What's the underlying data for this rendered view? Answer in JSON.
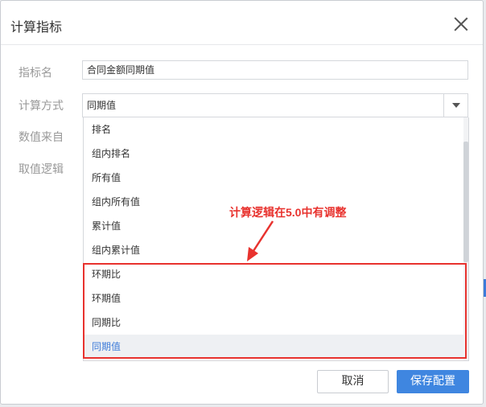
{
  "dialog": {
    "title": "计算指标",
    "close_icon": "close-icon"
  },
  "form": {
    "name_label": "指标名",
    "name_value": "合同金额同期值",
    "calc_label": "计算方式",
    "calc_value": "同期值",
    "source_label": "数值来自",
    "logic_label": "取值逻辑"
  },
  "dropdown": {
    "options": [
      "排名",
      "组内排名",
      "所有值",
      "组内所有值",
      "累计值",
      "组内累计值",
      "环期比",
      "环期值",
      "同期比",
      "同期值"
    ],
    "selected": "同期值"
  },
  "annotation": {
    "text": "计算逻辑在5.0中有调整",
    "color": "#e8322e"
  },
  "footer": {
    "cancel_label": "取消",
    "save_label": "保存配置"
  },
  "colors": {
    "accent": "#3f86e0",
    "selected_text": "#3d7bd9"
  }
}
